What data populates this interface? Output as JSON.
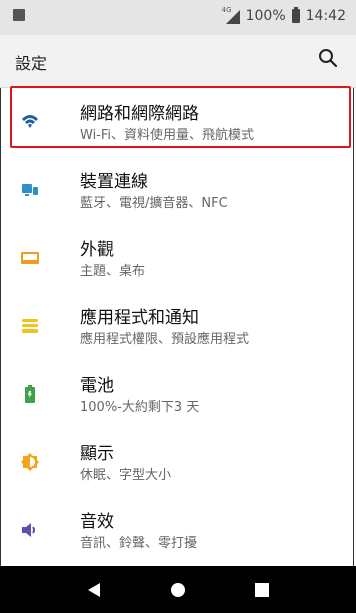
{
  "status_bar": {
    "network_label": "4G",
    "battery_text": "100%",
    "time": "14:42"
  },
  "app_bar": {
    "title": "設定",
    "search_icon": "search-icon"
  },
  "settings_items": [
    {
      "title": "網路和網際網路",
      "subtitle": "Wi-Fi、資料使用量、飛航模式",
      "icon": "wifi-icon",
      "icon_color": "#1f5fa0",
      "highlighted": true
    },
    {
      "title": "裝置連線",
      "subtitle": "藍牙、電視/擴音器、NFC",
      "icon": "device-connection-icon",
      "icon_color": "#2f8fc8"
    },
    {
      "title": "外觀",
      "subtitle": "主題、桌布",
      "icon": "display-icon",
      "icon_color": "#f29b1c"
    },
    {
      "title": "應用程式和通知",
      "subtitle": "應用程式權限、預設應用程式",
      "icon": "apps-icon",
      "icon_color": "#f2c31c"
    },
    {
      "title": "電池",
      "subtitle": "100%-大約剩下3 天",
      "icon": "battery-icon",
      "icon_color": "#3fa24a"
    },
    {
      "title": "顯示",
      "subtitle": "休眠、字型大小",
      "icon": "brightness-icon",
      "icon_color": "#f2a61c"
    },
    {
      "title": "音效",
      "subtitle": "音訊、鈴聲、零打擾",
      "icon": "volume-icon",
      "icon_color": "#5b4fb0"
    }
  ],
  "nav_bar": {
    "back_icon": "back-icon",
    "home_icon": "home-icon",
    "recents_icon": "recents-icon"
  }
}
